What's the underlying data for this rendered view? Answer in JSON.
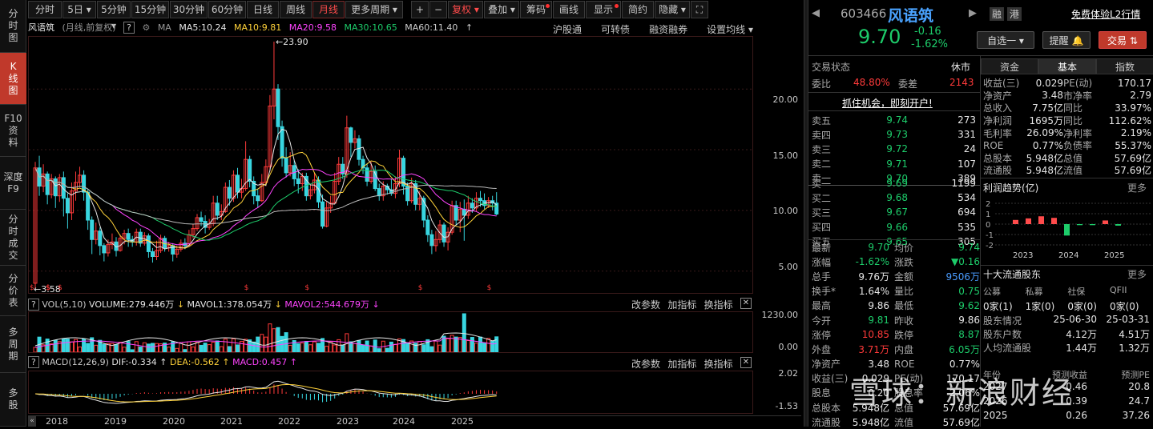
{
  "left_tabs": [
    {
      "id": "fenshitu",
      "label": "分\n时\n图",
      "active": false
    },
    {
      "id": "kxiantu",
      "label": "K\n线\n图",
      "active": true
    },
    {
      "id": "f10",
      "label": "F10\n资\n料",
      "active": false
    },
    {
      "id": "shendu",
      "label": "深度\nF9",
      "active": false
    },
    {
      "id": "fenshichengjiao",
      "label": "分\n时\n成\n交",
      "active": false
    },
    {
      "id": "fenjiabiao",
      "label": "分\n价\n表",
      "active": false
    },
    {
      "id": "duozhouqi",
      "label": "多\n周\n期",
      "active": false
    },
    {
      "id": "duo",
      "label": "多\n股",
      "active": false
    }
  ],
  "periods": [
    "分时",
    "5日",
    "5分钟",
    "15分钟",
    "30分钟",
    "60分钟",
    "日线",
    "周线",
    "月线",
    "更多周期"
  ],
  "period_active": "月线",
  "tools": [
    "复权",
    "叠加",
    "筹码",
    "画线",
    "显示",
    "简约",
    "隐藏"
  ],
  "chart_header": {
    "name": "风语筑",
    "mode": "(月线,前复权)",
    "ma_label": "MA",
    "ma5": "MA5:10.24",
    "ma10": "MA10:9.81",
    "ma20": "MA20:9.58",
    "ma30": "MA30:10.65",
    "ma60": "MA60:11.40",
    "links": [
      "沪股通",
      "可转债",
      "融资融券",
      "设置均线"
    ]
  },
  "price_axis": [
    "20.00",
    "15.00",
    "10.00",
    "5.00"
  ],
  "annot_high": "23.90",
  "annot_low": "3.58",
  "vol_header": {
    "label": "VOL(5,10)",
    "volume": "VOLUME:279.446万",
    "mavol1": "MAVOL1:378.054万",
    "mavol2": "MAVOL2:544.679万",
    "links": [
      "改参数",
      "加指标",
      "换指标"
    ]
  },
  "vol_axis": [
    "1230.00",
    "0.00"
  ],
  "macd_header": {
    "label": "MACD(12,26,9)",
    "dif": "DIF:-0.334",
    "dea": "DEA:-0.562",
    "macd": "MACD:0.457",
    "links": [
      "改参数",
      "加指标",
      "换指标"
    ]
  },
  "macd_axis": [
    "2.02",
    "-1.53"
  ],
  "x_years": [
    "2018",
    "2019",
    "2020",
    "2021",
    "2022",
    "2023",
    "2024",
    "2025"
  ],
  "quote": {
    "code": "603466",
    "name": "风语筑",
    "tag1": "融",
    "tag2": "港",
    "promo": "免费体验L2行情",
    "price": "9.70",
    "change": "-0.16",
    "pct": "-1.62%",
    "btn_zixuan": "自选一",
    "btn_tixing": "提醒",
    "btn_jiaoyi": "交易"
  },
  "status": {
    "label": "交易状态",
    "value": "休市",
    "weibi_l": "委比",
    "weibi": "48.80%",
    "weicha_l": "委差",
    "weicha": "2143",
    "promo": "抓住机会，即刻开户!"
  },
  "asks": [
    [
      "卖五",
      "9.74",
      "273"
    ],
    [
      "卖四",
      "9.73",
      "331"
    ],
    [
      "卖三",
      "9.72",
      "24"
    ],
    [
      "卖二",
      "9.71",
      "107"
    ],
    [
      "卖一",
      "9.70",
      "389"
    ]
  ],
  "bids": [
    [
      "买一",
      "9.69",
      "1199"
    ],
    [
      "买二",
      "9.68",
      "534"
    ],
    [
      "买三",
      "9.67",
      "694"
    ],
    [
      "买四",
      "9.66",
      "535"
    ],
    [
      "买五",
      "9.65",
      "305"
    ]
  ],
  "stats": [
    [
      "最新",
      "9.70",
      "均价",
      "9.74"
    ],
    [
      "涨幅",
      "-1.62%",
      "涨跌",
      "▼0.16"
    ],
    [
      "总手",
      "9.76万",
      "金额",
      "9506万"
    ],
    [
      "换手*",
      "1.64%",
      "量比",
      "0.75"
    ],
    [
      "最高",
      "9.86",
      "最低",
      "9.62"
    ],
    [
      "今开",
      "9.81",
      "昨收",
      "9.86"
    ],
    [
      "涨停",
      "10.85",
      "跌停",
      "8.87"
    ],
    [
      "外盘",
      "3.71万",
      "内盘",
      "6.05万"
    ],
    [
      "净资产",
      "3.48",
      "ROE",
      "0.77%"
    ],
    [
      "收益(三)",
      "0.029",
      "PE(动)",
      "170.17"
    ],
    [
      "股息",
      "0.20",
      "股息率",
      "2.06%"
    ],
    [
      "总股本",
      "5.948亿",
      "总值",
      "57.69亿"
    ],
    [
      "流通股",
      "5.948亿",
      "流值",
      "57.69亿"
    ]
  ],
  "fin_tabs": [
    "资金",
    "基本",
    "指数"
  ],
  "fin_tab_active": "基本",
  "fin": [
    [
      "收益(三)",
      "0.029",
      "PE(动)",
      "170.17"
    ],
    [
      "净资产",
      "3.48",
      "市净率",
      "2.79"
    ],
    [
      "总收入",
      "7.75亿",
      "同比",
      "33.97%"
    ],
    [
      "净利润",
      "1695万",
      "同比",
      "112.62%"
    ],
    [
      "毛利率",
      "26.09%",
      "净利率",
      "2.19%"
    ],
    [
      "ROE",
      "0.77%",
      "负债率",
      "55.37%"
    ],
    [
      "总股本",
      "5.948亿",
      "总值",
      "57.69亿"
    ],
    [
      "流通股",
      "5.948亿",
      "流值",
      "57.69亿"
    ]
  ],
  "profit_trend": {
    "title": "利润趋势(亿)",
    "more": "更多",
    "yticks": [
      "2",
      "1",
      "0",
      "-1",
      "-2"
    ],
    "years": [
      "2023",
      "2024",
      "2025"
    ],
    "bars": [
      0.4,
      0.55,
      0.75,
      0.6,
      -1.1,
      -0.1,
      -0.1,
      0.35,
      -0.15
    ]
  },
  "holders": {
    "title": "十大流通股东",
    "more": "更多",
    "cols": [
      "公募",
      "私募",
      "社保",
      "QFII"
    ],
    "vals": [
      "0家(1)",
      "1家(0)",
      "0家(0)",
      "0家(0)"
    ],
    "rows": [
      [
        "股东情况",
        "25-06-30",
        "25-03-31"
      ],
      [
        "股东户数",
        "4.12万",
        "4.51万"
      ],
      [
        "人均流通股",
        "1.44万",
        "1.32万"
      ]
    ]
  },
  "forecast": {
    "col1": "年份",
    "col2": "预测收益",
    "col3": "预测PE",
    "rows": [
      [
        "2027",
        "0.46",
        "20.8"
      ],
      [
        "2026",
        "0.39",
        "24.7"
      ],
      [
        "2025",
        "0.26",
        "37.26"
      ]
    ]
  },
  "watermark": "雪球：新浪财经",
  "chart_data": {
    "type": "candlestick",
    "title": "风语筑 (月线,前复权)",
    "x": [
      "2018",
      "2019",
      "2020",
      "2021",
      "2022",
      "2023",
      "2024",
      "2025"
    ],
    "ylim": [
      3.58,
      23.9
    ],
    "candles": [
      [
        4,
        13.5,
        12,
        14
      ],
      [
        13.5,
        12,
        11.2,
        14.5
      ],
      [
        12,
        13,
        11.5,
        13.8
      ],
      [
        13,
        11.3,
        10.5,
        13.2
      ],
      [
        11.3,
        12.6,
        11,
        13
      ],
      [
        12.6,
        11.2,
        10.2,
        12.8
      ],
      [
        11.2,
        12.7,
        10.7,
        13
      ],
      [
        12.7,
        11,
        9.5,
        13.2
      ],
      [
        11,
        9.8,
        8.5,
        11.4
      ],
      [
        9.8,
        11.6,
        9.2,
        12.3
      ],
      [
        11.6,
        12.3,
        10.8,
        13.2
      ],
      [
        12.3,
        12.9,
        11.9,
        13.6
      ],
      [
        12.9,
        11.5,
        10.8,
        13.3
      ],
      [
        11.5,
        9.2,
        8.4,
        11.7
      ],
      [
        9.2,
        7.6,
        6.4,
        9.5
      ],
      [
        7.6,
        8.3,
        7.2,
        9
      ],
      [
        8.3,
        7.1,
        6.3,
        8.6
      ],
      [
        7.1,
        6.5,
        5.8,
        7.3
      ],
      [
        6.5,
        7.2,
        6.2,
        7.6
      ],
      [
        7.2,
        7.4,
        6.8,
        8.1
      ],
      [
        7.4,
        6.7,
        6.2,
        7.8
      ],
      [
        6.7,
        7.7,
        6.6,
        8
      ],
      [
        7.7,
        8.1,
        7.2,
        8.4
      ],
      [
        8.1,
        7.6,
        7,
        8.5
      ],
      [
        7.6,
        7.4,
        7,
        7.9
      ],
      [
        7.4,
        8.2,
        7.1,
        8.5
      ],
      [
        8.2,
        7.3,
        7,
        8.5
      ],
      [
        7.3,
        7.9,
        7.1,
        8.2
      ],
      [
        7.9,
        6.6,
        6.1,
        8.1
      ],
      [
        6.6,
        6.2,
        5.7,
        6.9
      ],
      [
        6.2,
        6.7,
        5.9,
        7.5
      ],
      [
        6.7,
        7.7,
        6.5,
        8
      ],
      [
        7.7,
        6.9,
        6.6,
        7.9
      ],
      [
        6.9,
        7.1,
        6.6,
        7.4
      ],
      [
        7.1,
        6.4,
        5.8,
        7.3
      ],
      [
        6.4,
        6.8,
        6.1,
        7.1
      ],
      [
        6.8,
        7.3,
        6.6,
        7.6
      ],
      [
        7.3,
        7.1,
        6.8,
        7.7
      ],
      [
        7.1,
        8,
        7,
        8.4
      ],
      [
        8,
        8.5,
        7.7,
        8.9
      ],
      [
        8.5,
        9.4,
        8.3,
        9.7
      ],
      [
        9.4,
        9.1,
        8.7,
        9.9
      ],
      [
        9.1,
        8.6,
        8.1,
        9.6
      ],
      [
        8.6,
        8.9,
        8.4,
        9.3
      ],
      [
        8.9,
        10.6,
        8.7,
        11.2
      ],
      [
        10.6,
        9.6,
        9.2,
        11.2
      ],
      [
        9.6,
        9.9,
        9.2,
        10.5
      ],
      [
        9.9,
        11.9,
        9.8,
        12.3
      ],
      [
        11.9,
        11,
        10.4,
        12.5
      ],
      [
        11,
        12.9,
        10.7,
        13.3
      ],
      [
        12.9,
        11.5,
        11,
        13.5
      ],
      [
        11.5,
        11.8,
        11,
        12.6
      ],
      [
        11.8,
        14.2,
        11.6,
        15.7
      ],
      [
        14.2,
        12.4,
        11.9,
        14.5
      ],
      [
        12.4,
        11.2,
        10.5,
        12.8
      ],
      [
        11.2,
        10.8,
        10.2,
        11.8
      ],
      [
        10.8,
        12.3,
        10.7,
        13
      ],
      [
        12.3,
        13.6,
        12,
        14.2
      ],
      [
        13.6,
        18.6,
        13.2,
        19.5
      ],
      [
        18.6,
        20,
        17.5,
        23.9
      ],
      [
        20,
        16.9,
        15.8,
        20.4
      ],
      [
        16.9,
        14.3,
        13.6,
        17.4
      ],
      [
        14.3,
        13.1,
        12.7,
        15.2
      ],
      [
        13.1,
        13.7,
        12.8,
        14.8
      ],
      [
        13.7,
        12.6,
        12,
        14.1
      ],
      [
        12.6,
        12.2,
        11.4,
        13.4
      ],
      [
        12.2,
        12.8,
        11.6,
        13.1
      ],
      [
        12.8,
        11.2,
        10.8,
        13.1
      ],
      [
        11.2,
        11.7,
        10.9,
        12.2
      ],
      [
        11.7,
        12.5,
        11.4,
        13.1
      ],
      [
        12.5,
        10.7,
        10.2,
        12.8
      ],
      [
        10.7,
        8.7,
        8.5,
        11.3
      ],
      [
        8.7,
        10.2,
        8.6,
        10.7
      ],
      [
        10.2,
        10.6,
        9.8,
        11.2
      ],
      [
        10.6,
        12.4,
        10.5,
        13.1
      ],
      [
        12.4,
        13.8,
        12.1,
        14.4
      ],
      [
        13.8,
        13,
        12.6,
        14.4
      ],
      [
        13,
        16.8,
        12.7,
        17.8
      ],
      [
        16.8,
        15.6,
        14.4,
        16.9
      ],
      [
        15.6,
        15.9,
        15.1,
        16.6
      ],
      [
        15.9,
        14.2,
        13.7,
        16.2
      ],
      [
        14.2,
        13.5,
        13,
        14.5
      ],
      [
        13.5,
        12.4,
        12,
        13.9
      ],
      [
        12.4,
        13.2,
        12.2,
        14
      ],
      [
        13.2,
        11.8,
        11.6,
        13.7
      ],
      [
        11.8,
        11.2,
        10.8,
        12.2
      ],
      [
        11.2,
        12,
        10.8,
        12.4
      ],
      [
        12,
        11.7,
        11.3,
        12.2
      ],
      [
        11.7,
        11.4,
        11.2,
        12.6
      ],
      [
        11.4,
        12.2,
        11,
        12.8
      ],
      [
        12.2,
        14.3,
        11.9,
        15
      ],
      [
        14.3,
        12,
        11.3,
        14.5
      ],
      [
        12,
        10.8,
        10.4,
        12.3
      ],
      [
        10.8,
        12.2,
        10.6,
        12.7
      ],
      [
        12.2,
        10.5,
        10,
        12.5
      ],
      [
        10.5,
        11,
        10,
        11.6
      ],
      [
        11,
        9.2,
        8.6,
        11.2
      ],
      [
        9.2,
        8,
        7.4,
        9.6
      ],
      [
        8,
        7.1,
        6.4,
        8.4
      ],
      [
        7.1,
        7.6,
        6.6,
        8.3
      ],
      [
        7.6,
        8.8,
        7.3,
        9.2
      ],
      [
        8.8,
        7.4,
        7,
        9
      ],
      [
        7.4,
        8.2,
        6.7,
        8.6
      ],
      [
        8.2,
        10.4,
        8,
        10.8
      ],
      [
        10.4,
        9.2,
        8.8,
        10.8
      ],
      [
        9.2,
        10.1,
        8.2,
        10.7
      ],
      [
        10.1,
        9.6,
        7.5,
        10.9
      ],
      [
        9.6,
        10.6,
        9.3,
        11.2
      ],
      [
        10.6,
        10.2,
        9.8,
        11
      ],
      [
        10.2,
        11,
        9.9,
        11.5
      ],
      [
        11,
        10.8,
        10.3,
        11.6
      ],
      [
        10.8,
        10.4,
        10.1,
        11.4
      ],
      [
        10.4,
        10.8,
        10.2,
        11.1
      ],
      [
        10.8,
        10.6,
        10,
        11.2
      ],
      [
        10.6,
        9.7,
        9.6,
        11.5
      ]
    ]
  }
}
